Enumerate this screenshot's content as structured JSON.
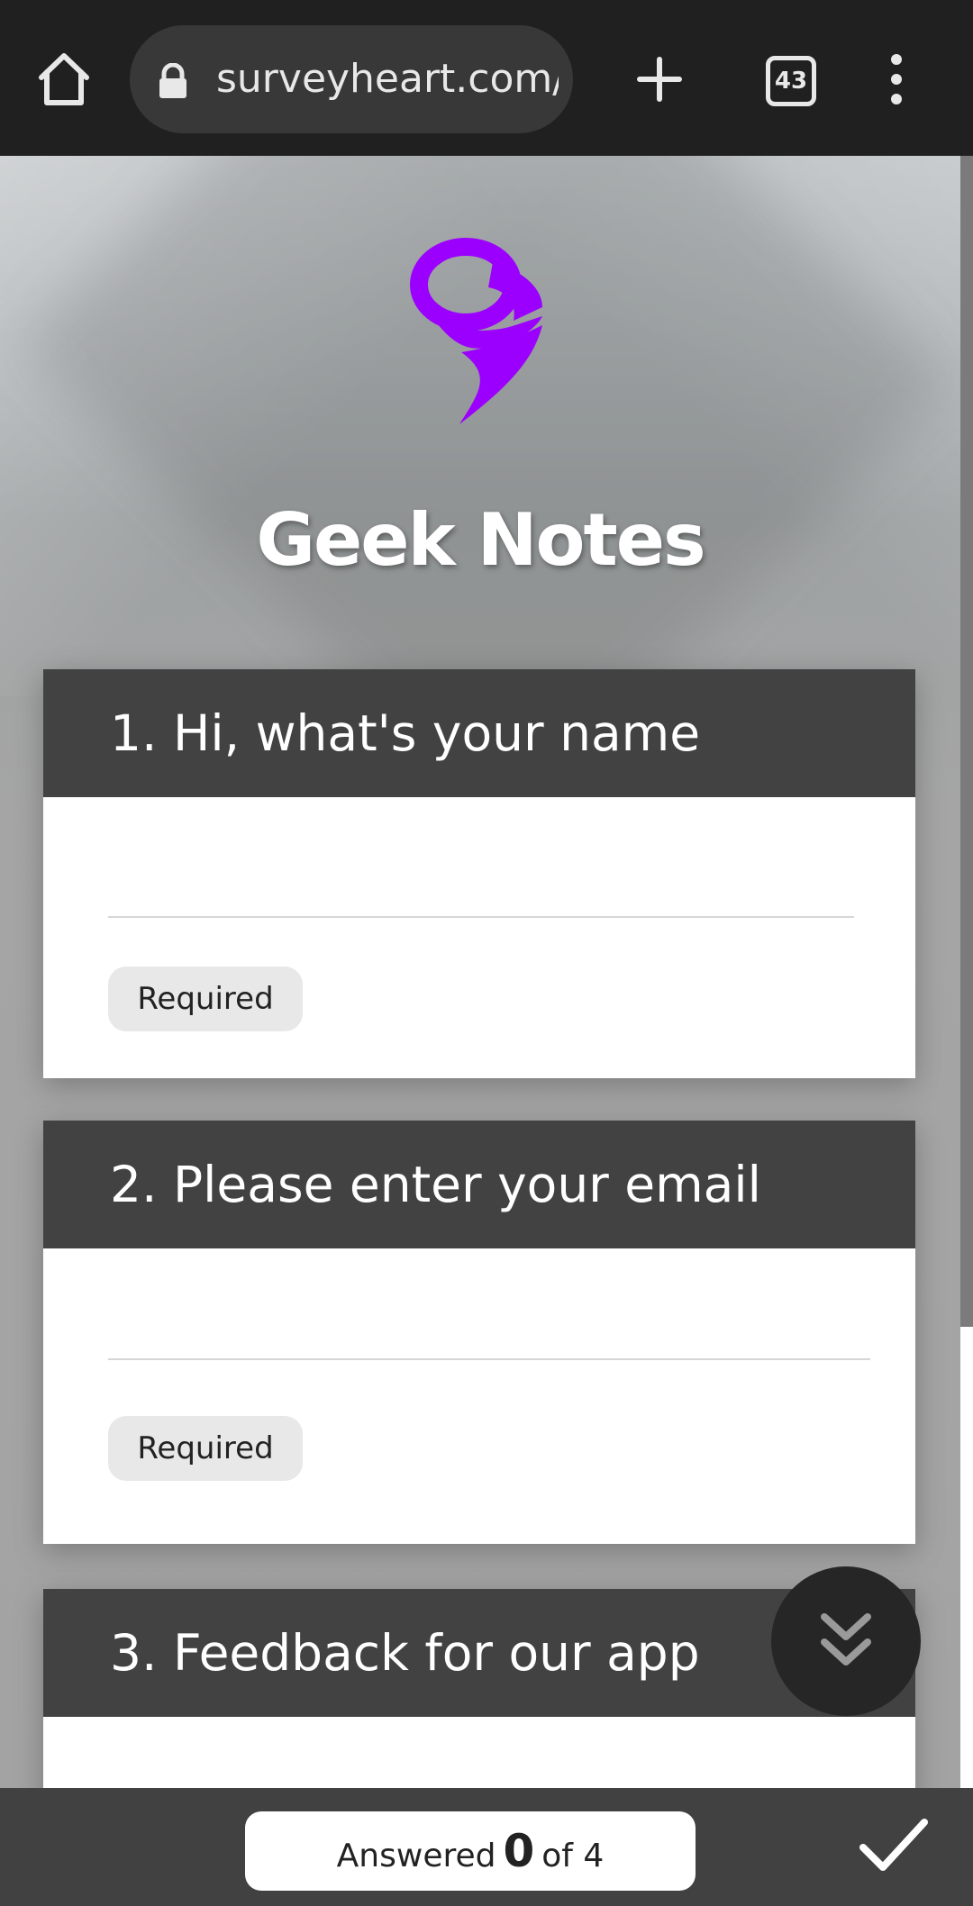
{
  "browser": {
    "url": "surveyheart.com/",
    "tab_count": "43"
  },
  "form": {
    "title": "Geek Notes",
    "questions": [
      {
        "label": "1. Hi, what's your name",
        "badge": "Required"
      },
      {
        "label": "2. Please enter your email",
        "badge": "Required"
      },
      {
        "label": "3. Feedback for our app"
      }
    ]
  },
  "footer": {
    "answered_prefix": "Answered",
    "answered_count": "0",
    "answered_suffix": "of 4"
  },
  "colors": {
    "accent": "#9b00ff",
    "card_header": "#424242",
    "bar": "#202020"
  },
  "icons": [
    "home-icon",
    "lock-icon",
    "plus-icon",
    "tabs-icon",
    "more-vert-icon",
    "logo-icon",
    "double-chevron-down-icon",
    "check-icon"
  ]
}
